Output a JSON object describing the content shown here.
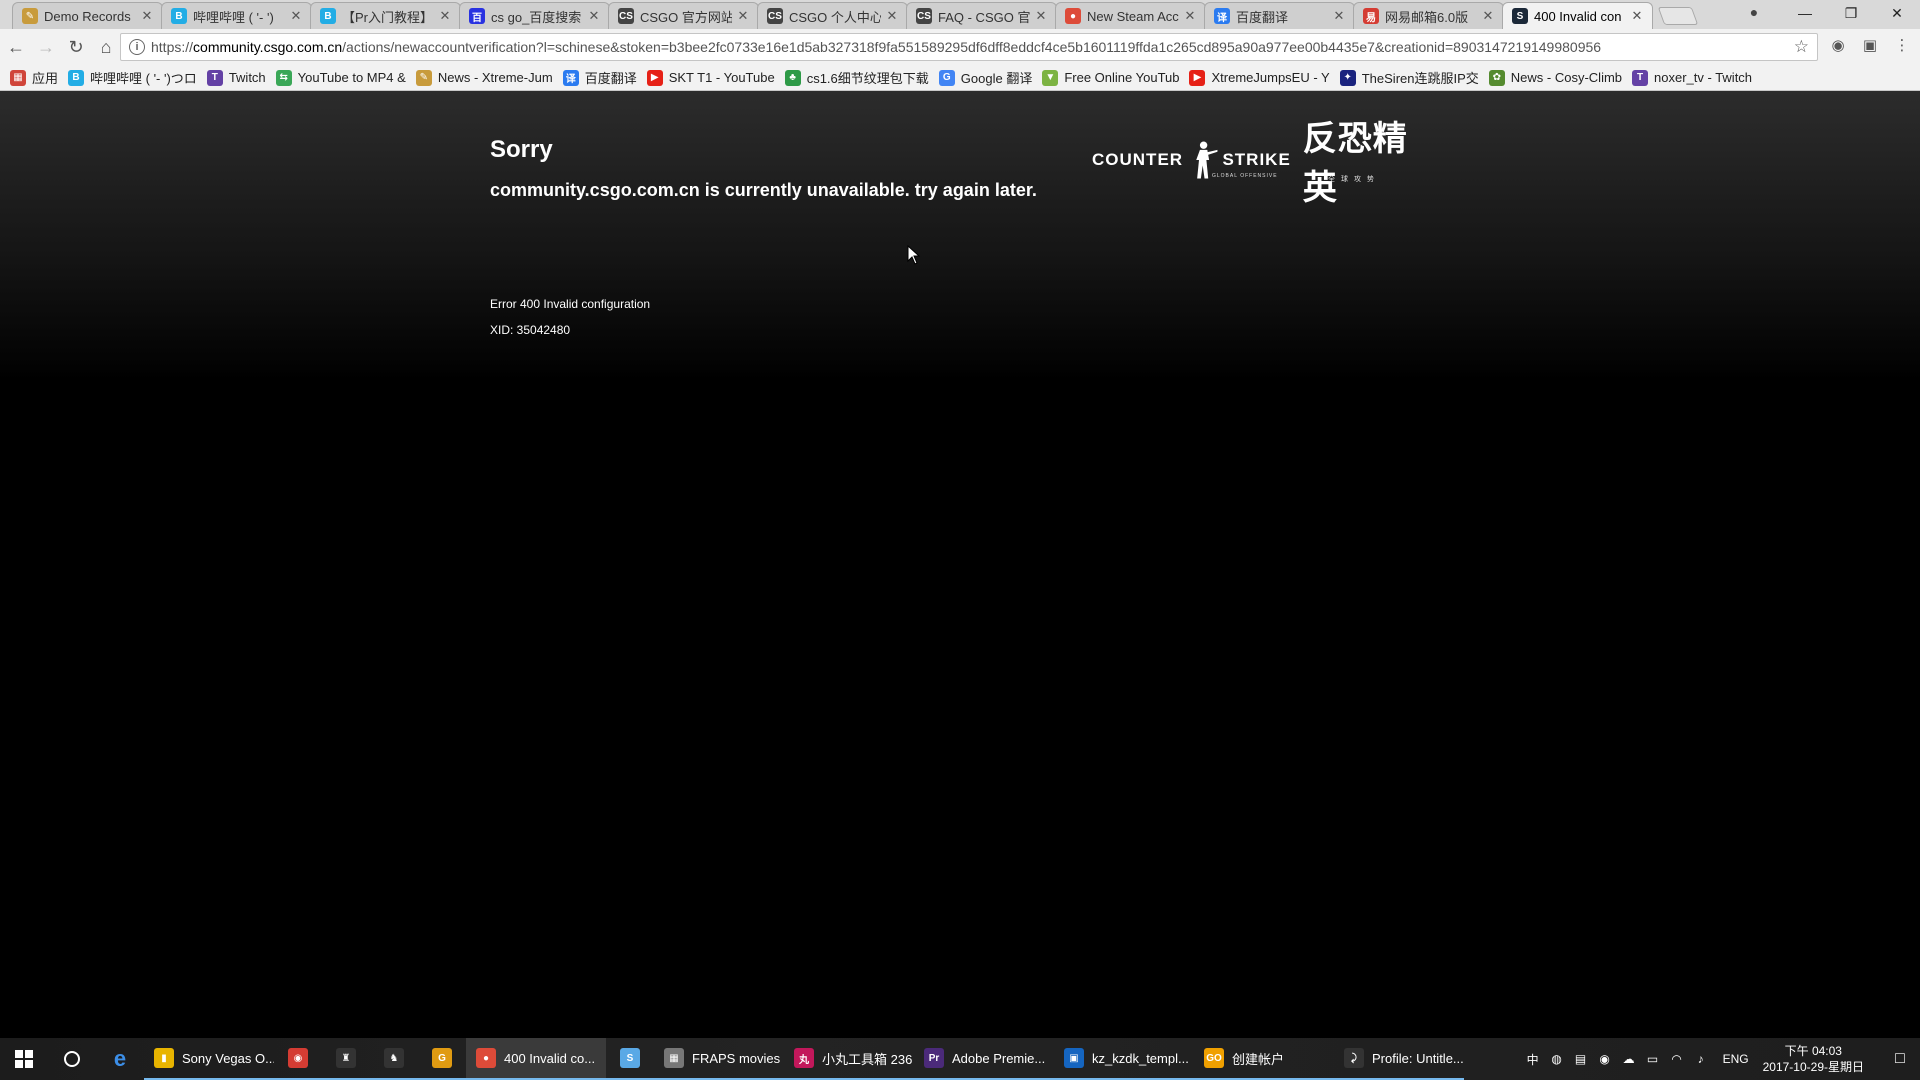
{
  "browser": {
    "tabs": [
      {
        "title": "Demo Records",
        "icon": "quill-icon",
        "color": "#c89b3c",
        "glyph": "✎"
      },
      {
        "title": "哔哩哔哩 ( '- ')",
        "icon": "bilibili-icon",
        "color": "#23ade5",
        "glyph": "B"
      },
      {
        "title": "【Pr入门教程】F",
        "icon": "bilibili-icon",
        "color": "#23ade5",
        "glyph": "B"
      },
      {
        "title": "cs go_百度搜索",
        "icon": "baidu-icon",
        "color": "#2932e1",
        "glyph": "百"
      },
      {
        "title": "CSGO 官方网站",
        "icon": "csgo-icon",
        "color": "#444444",
        "glyph": "CS"
      },
      {
        "title": "CSGO 个人中心",
        "icon": "csgo-icon",
        "color": "#444444",
        "glyph": "CS"
      },
      {
        "title": "FAQ - CSGO 官",
        "icon": "csgo-icon",
        "color": "#444444",
        "glyph": "CS"
      },
      {
        "title": "New Steam Acc",
        "icon": "chrome-icon",
        "color": "#dd4b39",
        "glyph": "●"
      },
      {
        "title": "百度翻译",
        "icon": "baidu-translate-icon",
        "color": "#2b7bf0",
        "glyph": "译"
      },
      {
        "title": "网易邮箱6.0版",
        "icon": "netease-mail-icon",
        "color": "#d43c33",
        "glyph": "易"
      },
      {
        "title": "400 Invalid con",
        "icon": "steam-icon",
        "color": "#1b2838",
        "glyph": "S",
        "active": true
      }
    ],
    "window_controls": {
      "minimize": "—",
      "restore": "❐",
      "close": "✕"
    },
    "profile_glyph": "●",
    "address": {
      "scheme": "https://",
      "host": "community.csgo.com.cn",
      "path": "/actions/newaccountverification?l=schinese&stoken=b3bee2fc0733e16e1d5ab327318f9fa551589295df6dff8eddcf4ce5b1601119ffda1c265cd895a90a977ee00b4435e7&creationid=8903147219149980956"
    },
    "bookmarks": [
      {
        "label": "应用",
        "icon": "apps-grid-icon",
        "color": "#d0453a",
        "glyph": "▦"
      },
      {
        "label": "哔哩哔哩 ( '- ')つロ",
        "icon": "bilibili-icon",
        "color": "#23ade5",
        "glyph": "B"
      },
      {
        "label": "Twitch",
        "icon": "twitch-icon",
        "color": "#6441a5",
        "glyph": "T"
      },
      {
        "label": "YouTube to MP4 &",
        "icon": "convert-icon",
        "color": "#3aa757",
        "glyph": "⇆"
      },
      {
        "label": "News - Xtreme-Jum",
        "icon": "quill-icon",
        "color": "#c89b3c",
        "glyph": "✎"
      },
      {
        "label": "百度翻译",
        "icon": "baidu-translate-icon",
        "color": "#2b7bf0",
        "glyph": "译"
      },
      {
        "label": "SKT T1 - YouTube",
        "icon": "youtube-icon",
        "color": "#e62117",
        "glyph": "▶"
      },
      {
        "label": "cs1.6细节纹理包下载",
        "icon": "plant-icon",
        "color": "#2e9a47",
        "glyph": "♣"
      },
      {
        "label": "Google 翻译",
        "icon": "google-translate-icon",
        "color": "#4285f4",
        "glyph": "G"
      },
      {
        "label": "Free Online YouTub",
        "icon": "download-icon",
        "color": "#7cb342",
        "glyph": "▼"
      },
      {
        "label": "XtremeJumpsEU - Y",
        "icon": "youtube-icon",
        "color": "#e62117",
        "glyph": "▶"
      },
      {
        "label": "TheSiren连跳服IP交",
        "icon": "siren-icon",
        "color": "#1a237e",
        "glyph": "✦"
      },
      {
        "label": "News - Cosy-Climb",
        "icon": "leaf-icon",
        "color": "#558b2f",
        "glyph": "✿"
      },
      {
        "label": "noxer_tv - Twitch",
        "icon": "twitch-icon",
        "color": "#6441a5",
        "glyph": "T"
      }
    ]
  },
  "page": {
    "title": "Sorry",
    "message": "community.csgo.com.cn is currently unavailable. try again later.",
    "error": "Error 400 Invalid configuration",
    "xid": "XID: 35042480",
    "logo": {
      "en": "COUNTER STRIKE",
      "en_sub": "GLOBAL OFFENSIVE",
      "cn": "反恐精英",
      "cn_sub": "全球攻势"
    }
  },
  "taskbar": {
    "apps": [
      {
        "label": "Sony Vegas O...",
        "icon": "folder-icon",
        "color": "#e8b400",
        "glyph": "▮",
        "width": 130
      },
      {
        "label": "",
        "icon": "netease-music-icon",
        "color": "#d43c33",
        "glyph": "◉",
        "width": 48
      },
      {
        "label": "",
        "icon": "qq-icon",
        "color": "#333333",
        "glyph": "♜",
        "width": 48
      },
      {
        "label": "",
        "icon": "csgo-icon",
        "color": "#333333",
        "glyph": "♞",
        "width": 48
      },
      {
        "label": "",
        "icon": "g-launcher-icon",
        "color": "#e09b12",
        "glyph": "G",
        "width": 48
      },
      {
        "label": "400 Invalid co...",
        "icon": "chrome-icon",
        "color": "#dd4b39",
        "glyph": "●",
        "width": 140,
        "active": true
      },
      {
        "label": "",
        "icon": "steam-icon",
        "color": "#5aa9e6",
        "glyph": "S",
        "width": 48
      },
      {
        "label": "FRAPS movies",
        "icon": "fraps-folder-icon",
        "color": "#777777",
        "glyph": "▦",
        "width": 130
      },
      {
        "label": "小丸工具箱 236",
        "icon": "xiaowan-icon",
        "color": "#c2185b",
        "glyph": "丸",
        "width": 130
      },
      {
        "label": "Adobe Premie...",
        "icon": "premiere-icon",
        "color": "#4b2a7a",
        "glyph": "Pr",
        "width": 140
      },
      {
        "label": "kz_kzdk_templ...",
        "icon": "image-viewer-icon",
        "color": "#1565c0",
        "glyph": "▣",
        "width": 140
      },
      {
        "label": "创建帐户",
        "icon": "csgo-icon",
        "color": "#f0a000",
        "glyph": "GO",
        "width": 140
      },
      {
        "label": "Profile: Untitle...",
        "icon": "fraps-icon",
        "color": "#333333",
        "glyph": "⤸",
        "width": 130
      }
    ],
    "tray_icons": [
      {
        "icon": "ime-icon",
        "glyph": "中"
      },
      {
        "icon": "network-globe-icon",
        "glyph": "◍"
      },
      {
        "icon": "battery-icon",
        "glyph": "▤"
      },
      {
        "icon": "netease-music-icon",
        "glyph": "◉"
      },
      {
        "icon": "cloud-icon",
        "glyph": "☁"
      },
      {
        "icon": "keyboard-icon",
        "glyph": "▭"
      },
      {
        "icon": "wifi-icon",
        "glyph": "◠"
      },
      {
        "icon": "volume-icon",
        "glyph": "♪"
      }
    ],
    "language": "ENG",
    "time": "下午 04:03",
    "date": "2017-10-29-星期日"
  }
}
